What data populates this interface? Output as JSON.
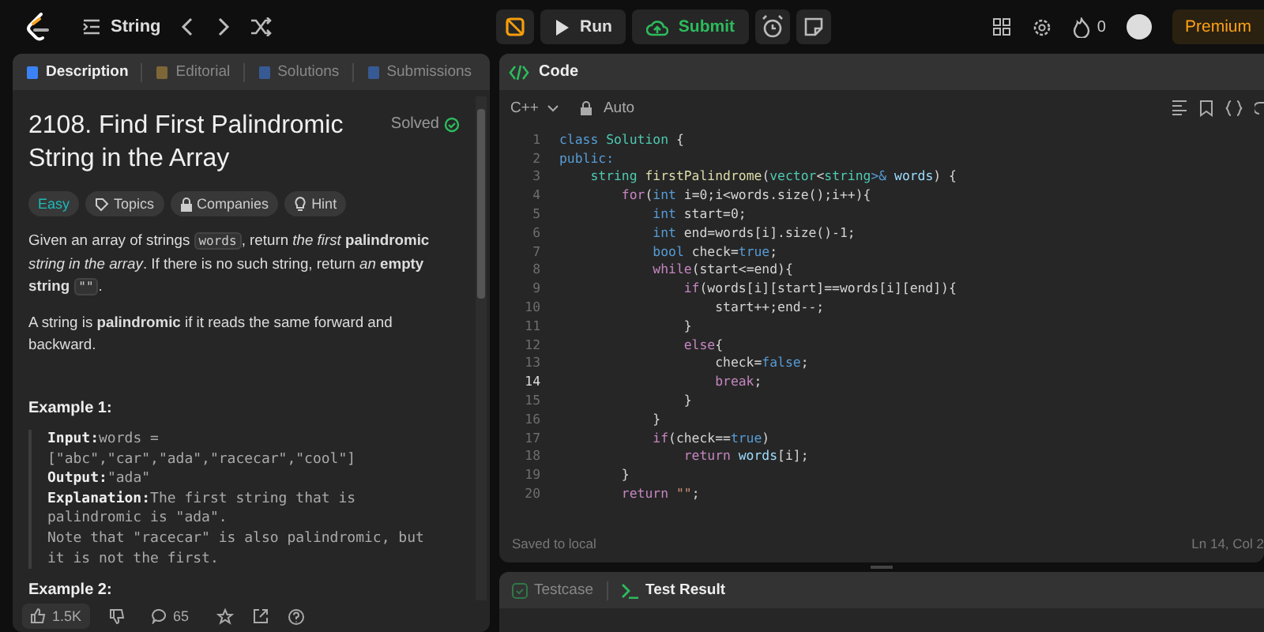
{
  "topbar": {
    "problem_list": "String",
    "actions": [
      {
        "label": "Run",
        "kind": "run"
      },
      {
        "label": "Submit",
        "kind": "submit"
      }
    ],
    "streak": "0",
    "premium": "Premium"
  },
  "left_tabs": [
    {
      "label": "Description",
      "kind": "description",
      "selected": true
    },
    {
      "label": "Editorial",
      "kind": "editorial",
      "selected": false
    },
    {
      "label": "Solutions",
      "kind": "solutions",
      "selected": false
    },
    {
      "label": "Submissions",
      "kind": "submissions",
      "selected": false
    }
  ],
  "problem": {
    "title": "2108. Find First Palindromic String in the Array",
    "status": "Solved",
    "tags": [
      {
        "label": "Easy",
        "kind": "difficulty"
      },
      {
        "label": "Topics",
        "kind": "topics"
      },
      {
        "label": "Companies",
        "kind": "companies"
      },
      {
        "label": "Hint",
        "kind": "hint"
      }
    ],
    "paragraphs": [
      [
        {
          "text": "Given an array of strings ",
          "kind": "text"
        },
        {
          "text": "words",
          "kind": "code"
        },
        {
          "text": ", return *the first* **palindromic** *string in the array*. If there is no such string, return *an* **empty string** ",
          "kind": "text"
        },
        {
          "text": "\"\"",
          "kind": "code"
        },
        {
          "text": ".",
          "kind": "text"
        }
      ],
      [
        {
          "text": "A string is **palindromic** if it reads the same forward and backward.",
          "kind": "text"
        }
      ]
    ],
    "examples": [
      {
        "heading": "Example 1:",
        "lines": [
          {
            "label": "Input:",
            "value": "words ="
          },
          {
            "value": "[\"abc\",\"car\",\"ada\",\"racecar\",\"cool\"]"
          },
          {
            "label": "Output:",
            "value": "\"ada\""
          },
          {
            "label": "Explanation:",
            "value": "The first string that is"
          },
          {
            "value": "palindromic is \"ada\"."
          },
          {
            "value": "Note that \"racecar\" is also palindromic, but"
          },
          {
            "value": "it is not the first."
          }
        ]
      },
      {
        "heading": "Example 2:"
      }
    ],
    "likes": "1.5K",
    "comments": "65"
  },
  "editor": {
    "title": "Code",
    "language": "C++",
    "mode": "Auto",
    "lines": [
      {
        "number": "1",
        "current": false,
        "tokens": [
          {
            "text": "class ",
            "kind": "keyword"
          },
          {
            "text": "Solution",
            "kind": "type"
          },
          {
            "text": " {",
            "kind": "plain"
          }
        ]
      },
      {
        "number": "2",
        "current": false,
        "tokens": [
          {
            "text": "public:",
            "kind": "keyword"
          }
        ]
      },
      {
        "number": "3",
        "current": false,
        "tokens": [
          {
            "text": "    string ",
            "kind": "type"
          },
          {
            "text": "firstPalindrome",
            "kind": "function"
          },
          {
            "text": "(",
            "kind": "plain"
          },
          {
            "text": "vector",
            "kind": "type"
          },
          {
            "text": "<",
            "kind": "plain"
          },
          {
            "text": "string",
            "kind": "type"
          },
          {
            "text": ">& ",
            "kind": "keyword"
          },
          {
            "text": "words",
            "kind": "variable"
          },
          {
            "text": ") {",
            "kind": "plain"
          }
        ]
      },
      {
        "number": "4",
        "current": false,
        "tokens": [
          {
            "text": "        for",
            "kind": "control"
          },
          {
            "text": "(",
            "kind": "plain"
          },
          {
            "text": "int ",
            "kind": "keyword"
          },
          {
            "text": "i=0;i<words.size();i++){",
            "kind": "plain"
          }
        ]
      },
      {
        "number": "5",
        "current": false,
        "tokens": [
          {
            "text": "            int ",
            "kind": "keyword"
          },
          {
            "text": "start=0;",
            "kind": "plain"
          }
        ]
      },
      {
        "number": "6",
        "current": false,
        "tokens": [
          {
            "text": "            int ",
            "kind": "keyword"
          },
          {
            "text": "end=words[i].size()-1;",
            "kind": "plain"
          }
        ]
      },
      {
        "number": "7",
        "current": false,
        "tokens": [
          {
            "text": "            bool ",
            "kind": "keyword"
          },
          {
            "text": "check=",
            "kind": "plain"
          },
          {
            "text": "true",
            "kind": "keyword"
          },
          {
            "text": ";",
            "kind": "plain"
          }
        ]
      },
      {
        "number": "8",
        "current": false,
        "tokens": [
          {
            "text": "            while",
            "kind": "control"
          },
          {
            "text": "(start<=end){",
            "kind": "plain"
          }
        ]
      },
      {
        "number": "9",
        "current": false,
        "tokens": [
          {
            "text": "                if",
            "kind": "control"
          },
          {
            "text": "(words[i][start]==words[i][end]){",
            "kind": "plain"
          }
        ]
      },
      {
        "number": "10",
        "current": false,
        "tokens": [
          {
            "text": "                    start++;end--;",
            "kind": "plain"
          }
        ]
      },
      {
        "number": "11",
        "current": false,
        "tokens": [
          {
            "text": "                }",
            "kind": "plain"
          }
        ]
      },
      {
        "number": "12",
        "current": false,
        "tokens": [
          {
            "text": "                else",
            "kind": "control"
          },
          {
            "text": "{",
            "kind": "plain"
          }
        ]
      },
      {
        "number": "13",
        "current": false,
        "tokens": [
          {
            "text": "                    check=",
            "kind": "plain"
          },
          {
            "text": "false",
            "kind": "keyword"
          },
          {
            "text": ";",
            "kind": "plain"
          }
        ]
      },
      {
        "number": "14",
        "current": true,
        "tokens": [
          {
            "text": "                    break",
            "kind": "control"
          },
          {
            "text": ";",
            "kind": "plain"
          }
        ]
      },
      {
        "number": "15",
        "current": false,
        "tokens": [
          {
            "text": "                }",
            "kind": "plain"
          }
        ]
      },
      {
        "number": "16",
        "current": false,
        "tokens": [
          {
            "text": "            }",
            "kind": "plain"
          }
        ]
      },
      {
        "number": "17",
        "current": false,
        "tokens": [
          {
            "text": "            if",
            "kind": "control"
          },
          {
            "text": "(check==",
            "kind": "plain"
          },
          {
            "text": "true",
            "kind": "keyword"
          },
          {
            "text": ")",
            "kind": "plain"
          }
        ]
      },
      {
        "number": "18",
        "current": false,
        "tokens": [
          {
            "text": "                return ",
            "kind": "control"
          },
          {
            "text": "words",
            "kind": "variable"
          },
          {
            "text": "[i];",
            "kind": "plain"
          }
        ]
      },
      {
        "number": "19",
        "current": false,
        "tokens": [
          {
            "text": "        }",
            "kind": "plain"
          }
        ]
      },
      {
        "number": "20",
        "current": false,
        "tokens": [
          {
            "text": "        return ",
            "kind": "control"
          },
          {
            "text": "\"\"",
            "kind": "string"
          },
          {
            "text": ";",
            "kind": "plain"
          }
        ]
      }
    ],
    "saved": "Saved to local",
    "cursor": "Ln 14, Col 2"
  },
  "bottom_tabs": [
    {
      "label": "Testcase",
      "kind": "testcase",
      "selected": false
    },
    {
      "label": "Test Result",
      "kind": "result",
      "selected": true
    }
  ]
}
